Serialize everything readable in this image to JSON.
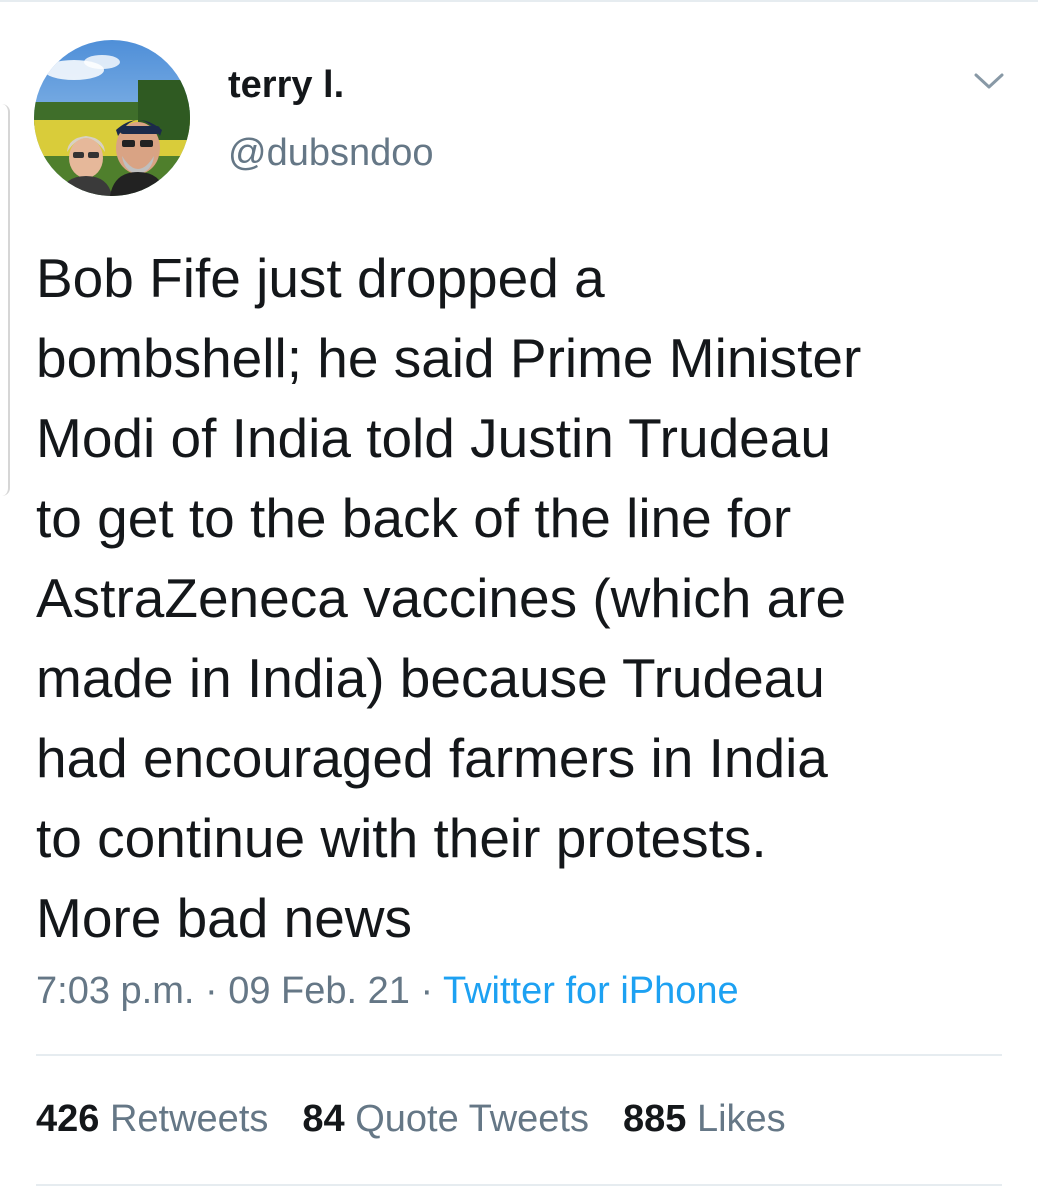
{
  "tweet": {
    "author": {
      "display_name": "terry l.",
      "handle": "@dubsndoo"
    },
    "text": "Bob Fife just dropped a\nbombshell; he said Prime Minister\nModi of India told Justin Trudeau\nto get to the back of the line for\nAstraZeneca vaccines (which are\nmade in India) because Trudeau\nhad encouraged farmers in India\nto continue with their protests.\nMore bad news",
    "time": "7:03 p.m.",
    "date": "09 Feb. 21",
    "separator": "·",
    "source": "Twitter for iPhone",
    "stats": {
      "retweets_count": "426",
      "retweets_label": "Retweets",
      "quotes_count": "84",
      "quotes_label": "Quote Tweets",
      "likes_count": "885",
      "likes_label": "Likes"
    }
  },
  "icons": {
    "menu": "chevron-down-icon"
  },
  "colors": {
    "text_primary": "#14171a",
    "text_secondary": "#657786",
    "link": "#1da1f2",
    "divider": "#e6ecf0"
  }
}
